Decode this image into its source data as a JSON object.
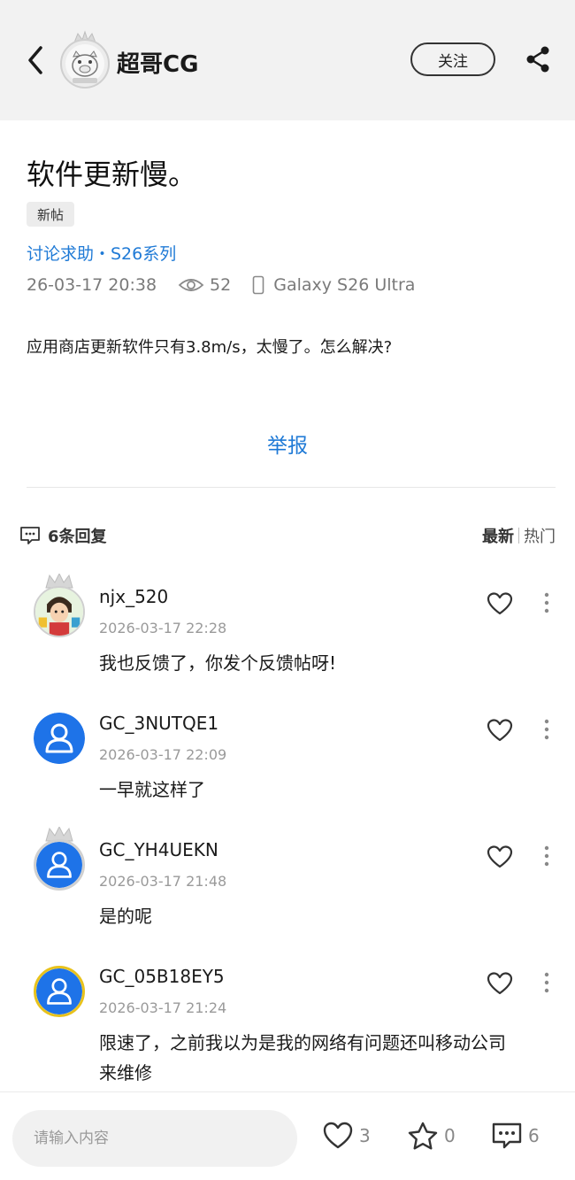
{
  "header": {
    "author_name": "超哥CG",
    "follow_label": "关注"
  },
  "post": {
    "title": "软件更新慢。",
    "tag": "新帖",
    "board": "讨论求助・S26系列",
    "datetime": "26-03-17 20:38",
    "views": "52",
    "device": "Galaxy S26 Ultra",
    "content": "应用商店更新软件只有3.8m/s，太慢了。怎么解决?",
    "report_label": "举报"
  },
  "replies": {
    "count_label": "6条回复",
    "sort_latest": "最新",
    "sort_hot": "热门",
    "items": [
      {
        "name": "njx_520",
        "time": "2026-03-17 22:28",
        "text": "我也反馈了，你发个反馈帖呀!",
        "avatar": "cartoon-avatar",
        "crown": true
      },
      {
        "name": "GC_3NUTQE1",
        "time": "2026-03-17 22:09",
        "text": "一早就这样了",
        "avatar": "default-user",
        "crown": false
      },
      {
        "name": "GC_YH4UEKN",
        "time": "2026-03-17 21:48",
        "text": "是的呢",
        "avatar": "default-user",
        "crown": true
      },
      {
        "name": "GC_05B18EY5",
        "time": "2026-03-17 21:24",
        "text": "限速了，之前我以为是我的网络有问题还叫移动公司来维修",
        "avatar": "default-user-gold",
        "crown": false
      }
    ]
  },
  "bottom": {
    "input_placeholder": "请输入内容",
    "likes": "3",
    "favorites": "0",
    "comments": "6"
  },
  "colors": {
    "accent_blue": "#1f7ad6",
    "avatar_blue": "#1e73e8",
    "header_bg": "#f2f2f2"
  }
}
